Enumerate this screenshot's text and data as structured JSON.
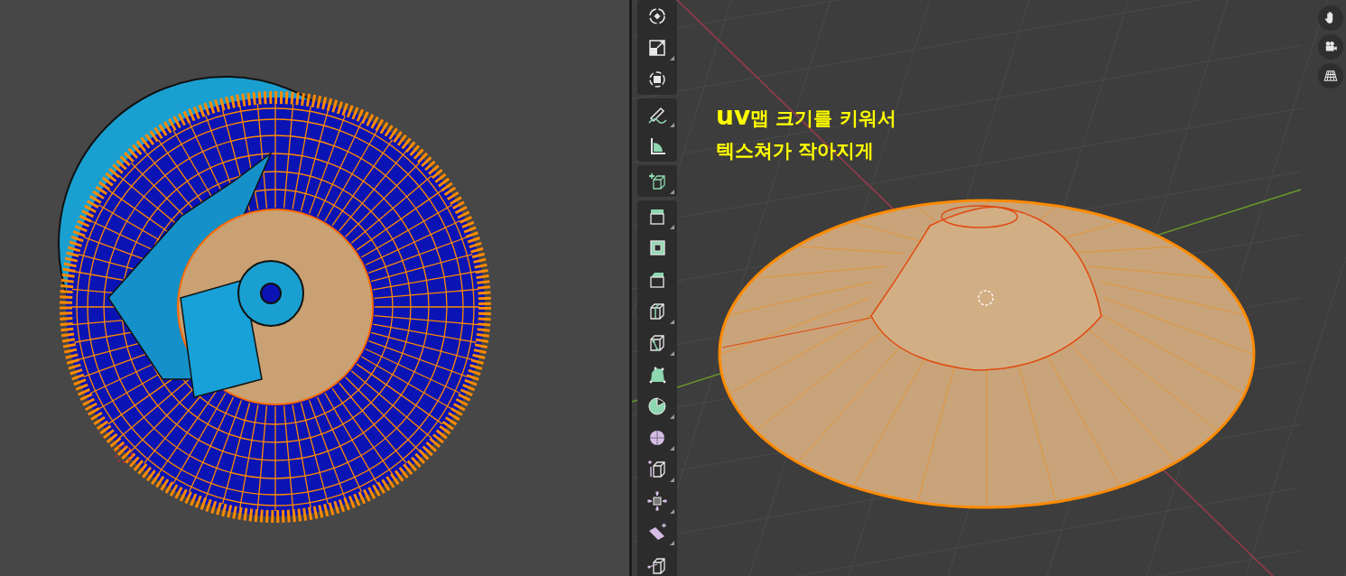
{
  "uv_editor": {
    "kind": "uv-mesh"
  },
  "viewport": {
    "annotation": [
      "**uv**맵 크기를 키워서",
      "텍스쳐가 작아지게"
    ],
    "tool_groups": [
      [
        {
          "kind": "rotate",
          "submenu": false
        },
        {
          "kind": "scale",
          "submenu": true
        },
        {
          "kind": "transform",
          "submenu": false
        }
      ],
      [
        {
          "kind": "annotate",
          "submenu": true
        },
        {
          "kind": "measure",
          "submenu": false
        }
      ],
      [
        {
          "kind": "add-cube",
          "submenu": true
        }
      ],
      [
        {
          "kind": "extrude",
          "submenu": true
        },
        {
          "kind": "inset",
          "submenu": false
        },
        {
          "kind": "bevel",
          "submenu": false
        },
        {
          "kind": "loop-cut",
          "submenu": true
        },
        {
          "kind": "knife",
          "submenu": true
        },
        {
          "kind": "poly-build",
          "submenu": false
        },
        {
          "kind": "spin",
          "submenu": true
        },
        {
          "kind": "smooth",
          "submenu": true
        },
        {
          "kind": "edge-slide",
          "submenu": true
        },
        {
          "kind": "shrink",
          "submenu": true
        },
        {
          "kind": "shear",
          "submenu": true
        },
        {
          "kind": "rip",
          "submenu": false
        }
      ]
    ],
    "nav_buttons": [
      {
        "kind": "hand"
      },
      {
        "kind": "camera"
      },
      {
        "kind": "grid"
      }
    ]
  }
}
